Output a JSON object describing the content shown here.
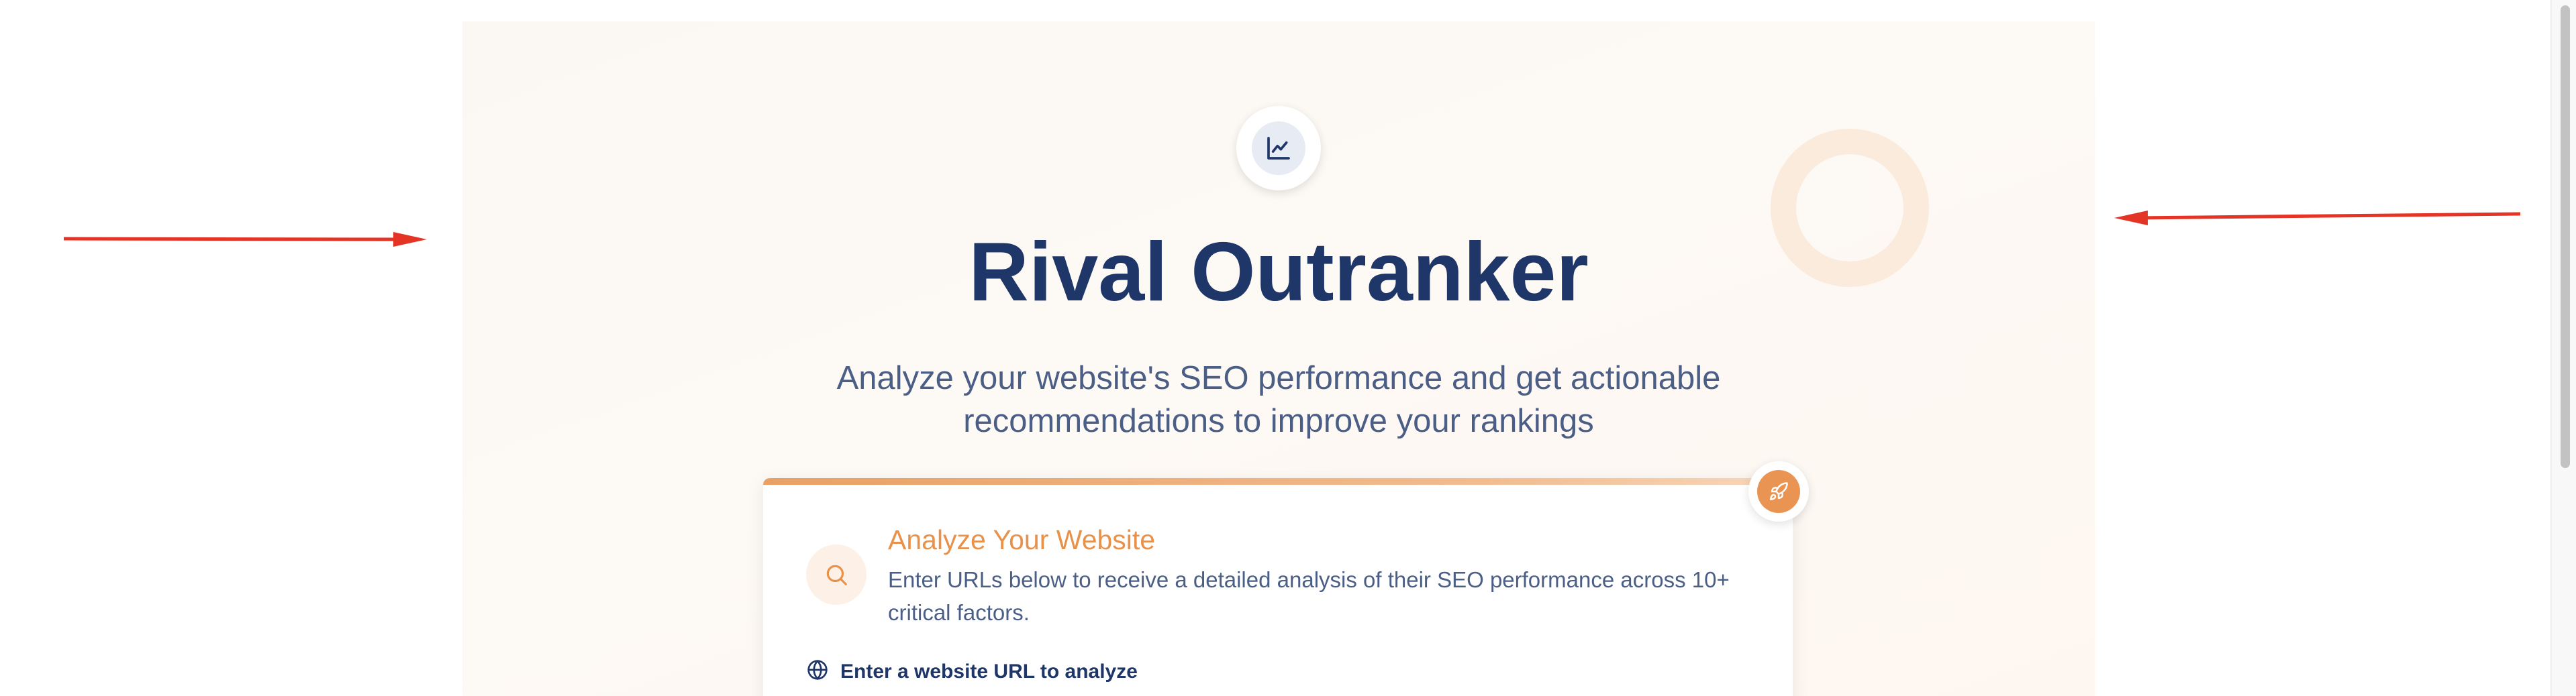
{
  "hero": {
    "title": "Rival Outranker",
    "subtitle": "Analyze your website's SEO performance and get actionable recommendations to improve your rankings",
    "logo_icon": "line-chart-icon"
  },
  "analyze_card": {
    "heading": "Analyze Your Website",
    "description": "Enter URLs below to receive a detailed analysis of their SEO performance across 10+ critical factors.",
    "url_label": "Enter a website URL to analyze",
    "icons": {
      "header": "search-icon",
      "corner": "rocket-icon",
      "url": "globe-icon"
    }
  },
  "colors": {
    "title": "#1f3668",
    "subtitle": "#4b5e85",
    "accent": "#e8914a",
    "annotation_arrow": "#e43426"
  }
}
